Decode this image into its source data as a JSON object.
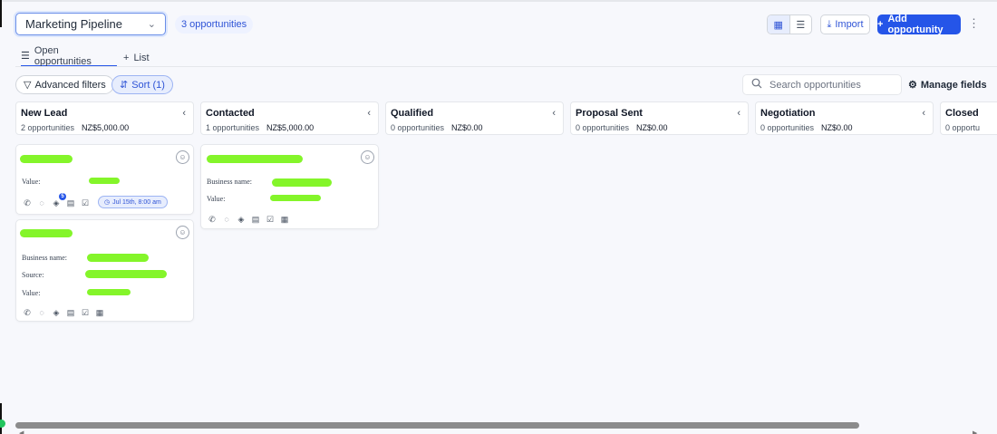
{
  "header": {
    "pipeline": "Marketing Pipeline",
    "count_badge": "3 opportunities",
    "import_label": "Import",
    "add_label": "Add opportunity"
  },
  "tabs": [
    {
      "label": "Open opportunities",
      "active": true
    },
    {
      "label": "List",
      "active": false
    }
  ],
  "filters": {
    "advanced_label": "Advanced filters",
    "sort_label": "Sort (1)",
    "search_placeholder": "Search opportunities",
    "manage_label": "Manage fields"
  },
  "columns": [
    {
      "name": "New Lead",
      "count": "2 opportunities",
      "amount": "NZ$5,000.00"
    },
    {
      "name": "Contacted",
      "count": "1 opportunities",
      "amount": "NZ$5,000.00"
    },
    {
      "name": "Qualified",
      "count": "0 opportunities",
      "amount": "NZ$0.00"
    },
    {
      "name": "Proposal Sent",
      "count": "0 opportunities",
      "amount": "NZ$0.00"
    },
    {
      "name": "Negotiation",
      "count": "0 opportunities",
      "amount": "NZ$0.00"
    },
    {
      "name": "Closed",
      "count": "0 opportu",
      "amount": ""
    }
  ],
  "cards": [
    {
      "labels": [
        "Value:"
      ],
      "task_badge": "Jul 15th, 8:00 am",
      "notif_count": "5"
    },
    {
      "labels": [
        "Business name:",
        "Value:"
      ]
    },
    {
      "labels": [
        "Business name:",
        "Source:",
        "Value:"
      ]
    }
  ],
  "colors": {
    "primary": "#2555e8",
    "redaction": "#84f52a"
  }
}
